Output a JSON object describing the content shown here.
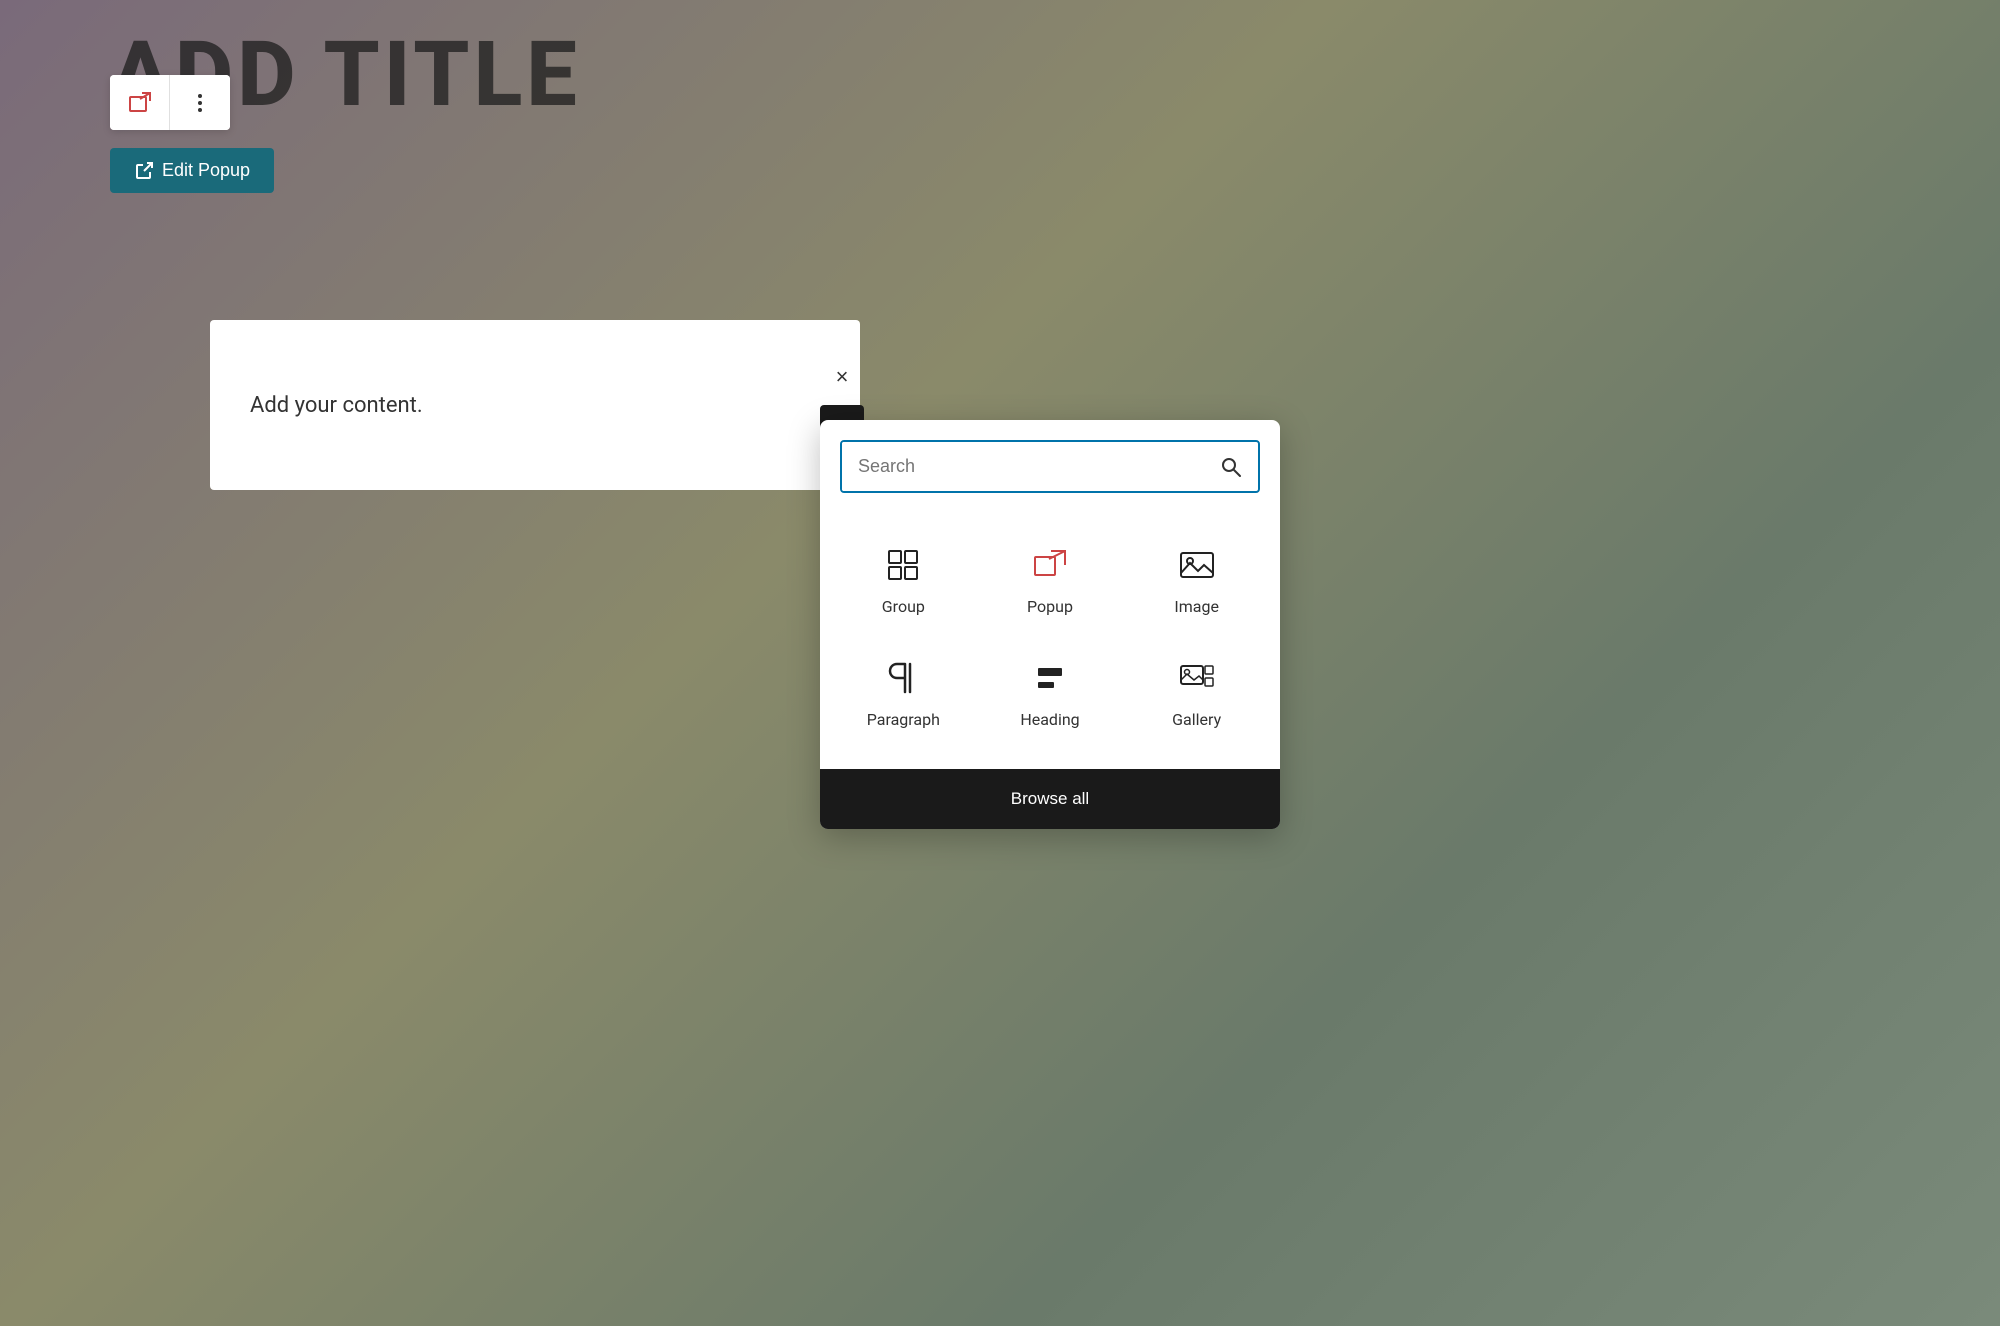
{
  "page": {
    "title": "ADD TITLE",
    "background": "muted-gradient"
  },
  "toolbar": {
    "popup_icon_label": "popup-icon",
    "more_options_label": "more-options"
  },
  "edit_popup_button": {
    "label": "Edit Popup",
    "icon": "external-link-icon"
  },
  "content_block": {
    "placeholder": "Add your content."
  },
  "block_controls": {
    "close_label": "×",
    "add_label": "+"
  },
  "inserter": {
    "search_placeholder": "Search",
    "blocks": [
      {
        "id": "group",
        "label": "Group",
        "icon": "group-icon"
      },
      {
        "id": "popup",
        "label": "Popup",
        "icon": "popup-icon"
      },
      {
        "id": "image",
        "label": "Image",
        "icon": "image-icon"
      },
      {
        "id": "paragraph",
        "label": "Paragraph",
        "icon": "paragraph-icon"
      },
      {
        "id": "heading",
        "label": "Heading",
        "icon": "heading-icon"
      },
      {
        "id": "gallery",
        "label": "Gallery",
        "icon": "gallery-icon"
      }
    ],
    "browse_all_label": "Browse all"
  }
}
